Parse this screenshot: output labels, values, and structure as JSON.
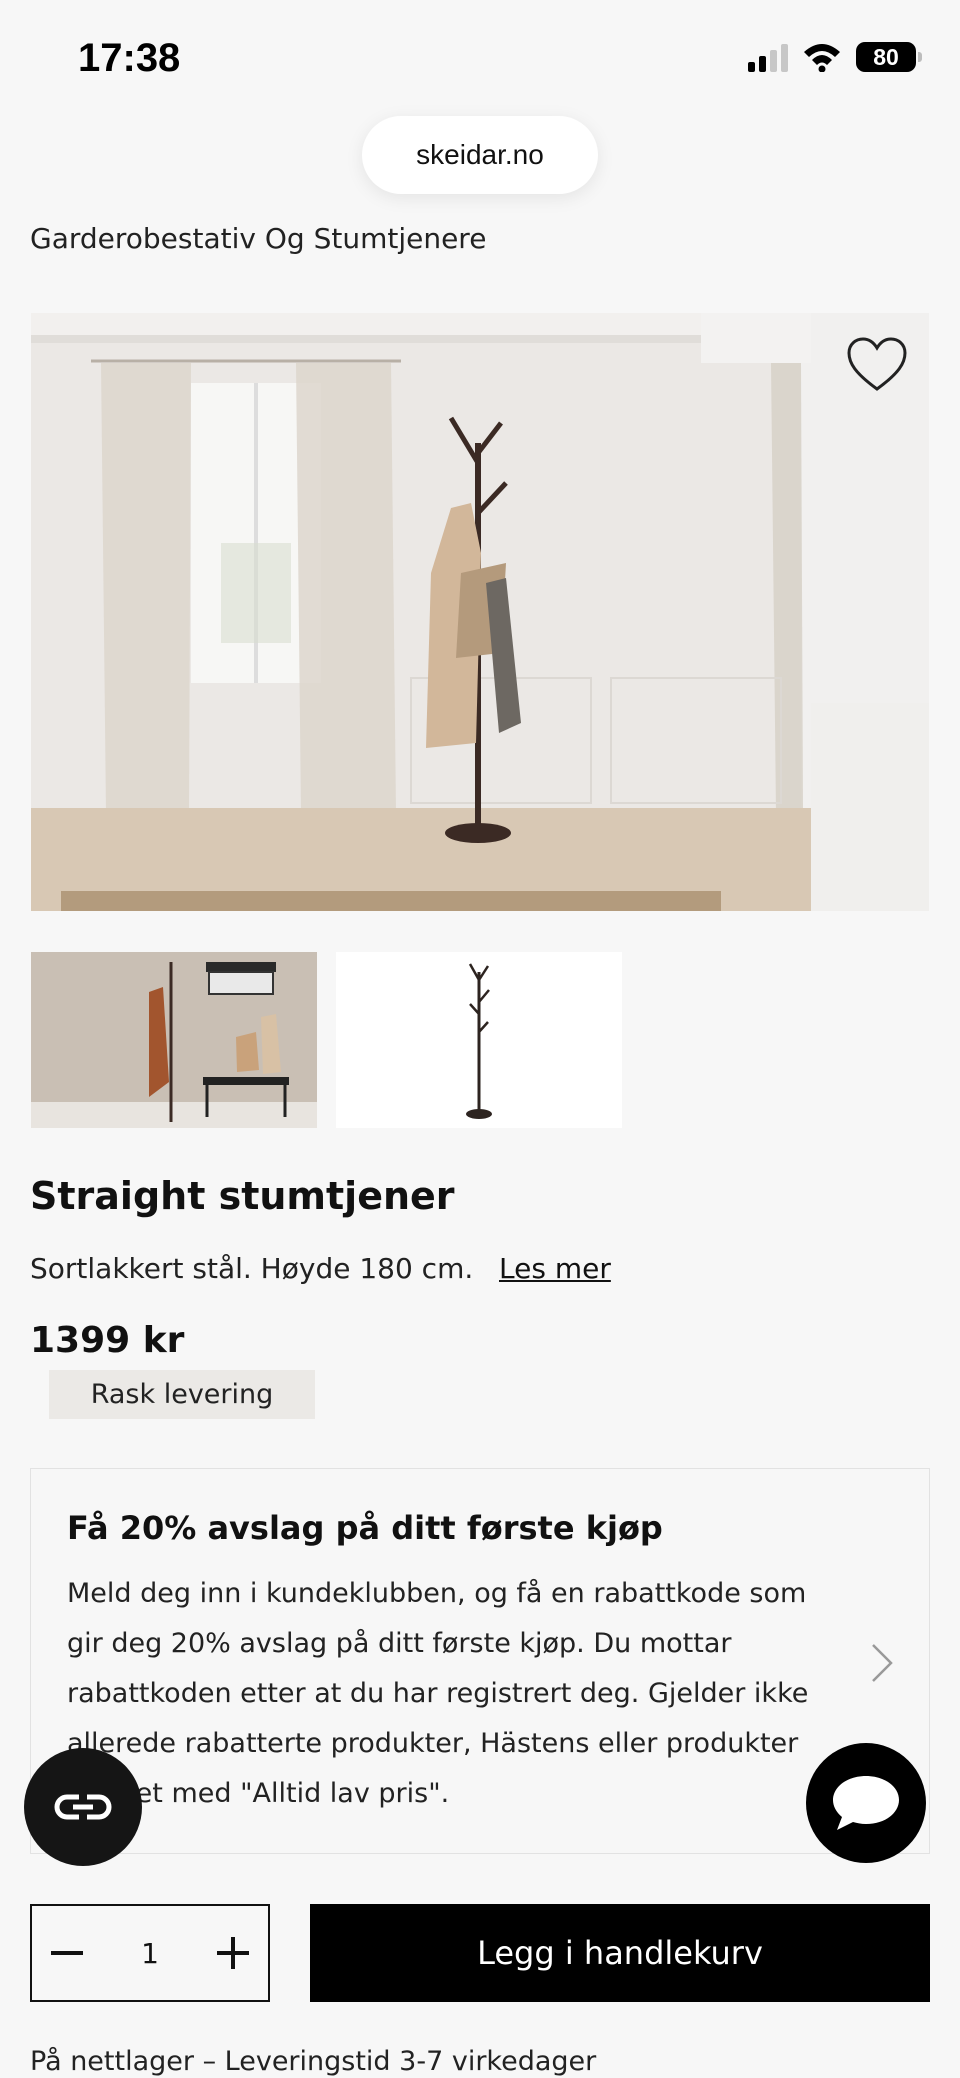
{
  "status_bar": {
    "time": "17:38",
    "battery": "80",
    "icons": [
      "signal-icon",
      "wifi-icon",
      "battery-icon"
    ]
  },
  "browser": {
    "url": "skeidar.no"
  },
  "breadcrumb": "Garderobestativ Og Stumtjenere",
  "gallery": {
    "main_image": "coat-stand-room-photo",
    "favorite_icon": "heart-icon",
    "thumbnails": [
      "coat-stand-hallway-photo",
      "coat-stand-product-cutout"
    ]
  },
  "product": {
    "title": "Straight stumtjener",
    "description": "Sortlakkert stål. Høyde 180 cm.",
    "read_more": "Les mer",
    "price": "1399 kr",
    "badge": "Rask levering"
  },
  "promo": {
    "title": "Få 20% avslag på ditt første kjøp",
    "body": "Meld deg inn i kundeklubben, og få en rabattkode som gir deg 20% avslag på ditt første kjøp. Du mottar rabattkoden etter at du har registrert deg. Gjelder ikke allerede rabatterte produkter, Hästens eller produkter merket med \"Alltid lav pris\".",
    "chevron_icon": "chevron-right-icon"
  },
  "cart": {
    "quantity": "1",
    "add_label": "Legg i handlekurv"
  },
  "delivery": "På nettlager – Leveringstid 3-7 virkedager",
  "colors": {
    "background": "#f7f7f7",
    "primary": "#000000",
    "badge_bg": "#ebe9e6"
  }
}
